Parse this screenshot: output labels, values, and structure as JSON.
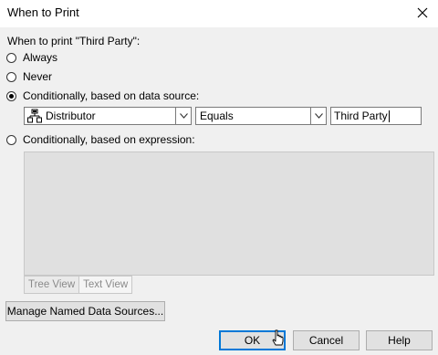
{
  "window": {
    "title": "When to Print"
  },
  "prompt": "When to print \"Third Party\":",
  "options": [
    {
      "label": "Always",
      "checked": false
    },
    {
      "label": "Never",
      "checked": false
    },
    {
      "label": "Conditionally, based on data source:",
      "checked": true
    },
    {
      "label": "Conditionally, based on expression:",
      "checked": false
    }
  ],
  "condition": {
    "data_source": {
      "value": "Distributor",
      "icon": "data-source-icon"
    },
    "operator": {
      "value": "Equals"
    },
    "compare_value": "Third Party"
  },
  "expression_tabs": [
    "Tree View",
    "Text View"
  ],
  "buttons": {
    "manage": "Manage Named Data Sources...",
    "ok": "OK",
    "cancel": "Cancel",
    "help": "Help"
  },
  "colors": {
    "dialog_bg": "#f0f0f0",
    "default_button_border": "#0078d7",
    "disabled_text": "#8a8a8a"
  }
}
